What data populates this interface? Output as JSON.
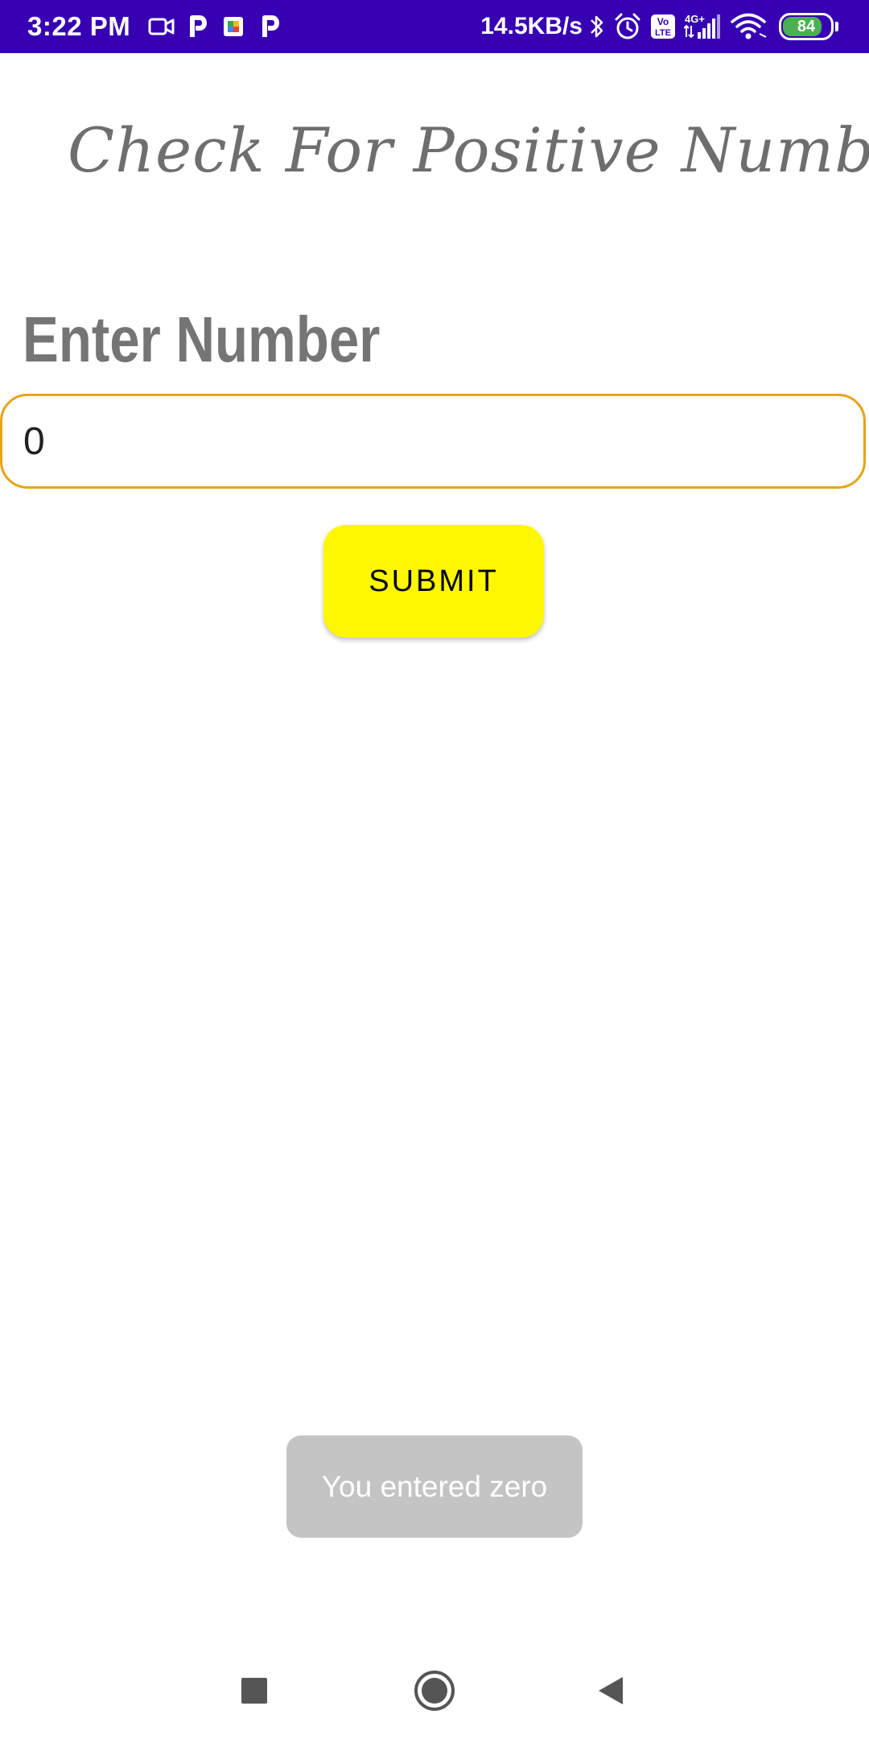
{
  "status_bar": {
    "time": "3:22 PM",
    "network_speed": "14.5KB/s",
    "battery_level": "84",
    "battery_fraction": 0.84,
    "icons_left": [
      "video-camera-icon",
      "p-app-icon",
      "meet-icon",
      "p-app-icon"
    ],
    "icons_right": [
      "bluetooth-icon",
      "alarm-icon",
      "volte-icon",
      "signal-4g-icon",
      "wifi-icon",
      "battery-icon"
    ],
    "network_type": "4G+",
    "volte_label": "Vo LTE"
  },
  "app": {
    "title": "Check For Positive Number",
    "input_label": "Enter Number",
    "input_value": "0",
    "submit_label": "SUBMIT"
  },
  "toast": {
    "message": "You entered zero"
  },
  "nav_bar": {
    "buttons": [
      "recents-square-icon",
      "home-circle-icon",
      "back-triangle-icon"
    ]
  },
  "colors": {
    "status_bar": "#3700b3",
    "input_border": "#e8a317",
    "submit_button": "#fff700",
    "title_text": "#6e6e6e",
    "label_text": "#757575",
    "toast_bg": "#c4c4c4",
    "battery_fill": "#4caf50"
  }
}
